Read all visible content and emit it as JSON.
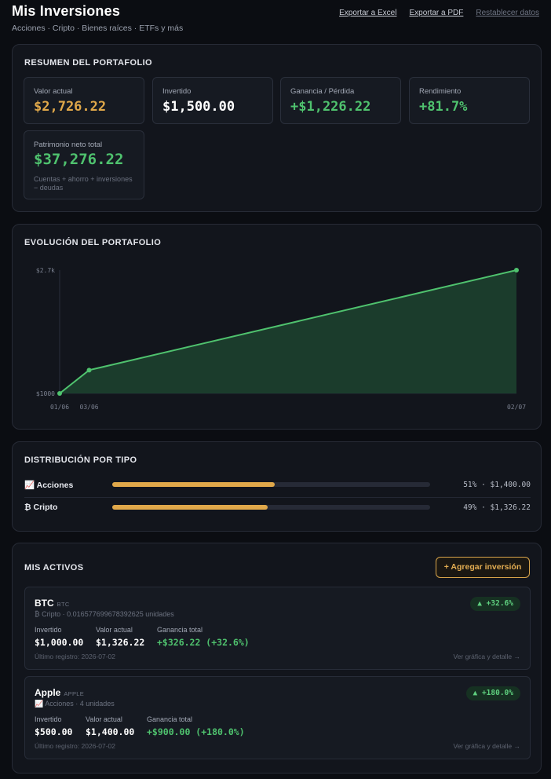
{
  "header": {
    "title": "Mis Inversiones",
    "subtitle": "Acciones · Cripto · Bienes raíces · ETFs y más",
    "links": [
      "Exportar a Excel",
      "Exportar a PDF",
      "Restablecer datos"
    ]
  },
  "summary": {
    "title": "RESUMEN DEL PORTAFOLIO",
    "stats": [
      {
        "label": "Valor actual",
        "value": "$2,726.22",
        "color": "#e0a84a"
      },
      {
        "label": "Invertido",
        "value": "$1,500.00",
        "color": "#ffffff"
      },
      {
        "label": "Ganancia / Pérdida",
        "value": "+$1,226.22",
        "color": "#4fc26e"
      },
      {
        "label": "Rendimiento",
        "value": "+81.7%",
        "color": "#4fc26e"
      }
    ],
    "net_worth": {
      "label": "Patrimonio neto total",
      "value": "$37,276.22",
      "note": "Cuentas + ahorro + inversiones − deudas"
    }
  },
  "evolution": {
    "title": "EVOLUCIÓN DEL PORTAFOLIO"
  },
  "chart_data": {
    "type": "area",
    "title": "",
    "x": [
      "01/06",
      "03/06",
      "02/07"
    ],
    "values": [
      1000,
      1326.22,
      2726.22
    ],
    "y_tick_labels": [
      "$2.7k",
      "$1000"
    ],
    "ylim": [
      1000,
      2726.22
    ],
    "xlabel": "",
    "ylabel": "",
    "grid": false,
    "line_color": "#4fc26e"
  },
  "distribution": {
    "title": "DISTRIBUCIÓN POR TIPO",
    "items": [
      {
        "icon": "📈",
        "name": "Acciones",
        "fraction": 0.51,
        "amount": "51% · $1,400.00"
      },
      {
        "icon": "₿",
        "name": "Cripto",
        "fraction": 0.49,
        "amount": "49% · $1,326.22"
      }
    ]
  },
  "assets": {
    "title": "MIS ACTIVOS",
    "add_button": "+ Agregar inversión",
    "items": [
      {
        "name": "BTC",
        "ticker": "BTC",
        "sub": "₿ Cripto · 0.016577699678392625 unidades",
        "badge": "▲ +32.6%",
        "invested_label": "Invertido",
        "invested": "$1,000.00",
        "current_label": "Valor actual",
        "current": "$1,326.22",
        "gain_label": "Ganancia total",
        "gain": "+$326.22 (+32.6%)",
        "last": "Último registro: 2026-07-02",
        "link": "Ver gráfica y detalle →"
      },
      {
        "name": "Apple",
        "ticker": "APPLE",
        "sub": "📈 Acciones · 4 unidades",
        "badge": "▲ +180.0%",
        "invested_label": "Invertido",
        "invested": "$500.00",
        "current_label": "Valor actual",
        "current": "$1,400.00",
        "gain_label": "Ganancia total",
        "gain": "+$900.00 (+180.0%)",
        "last": "Último registro: 2026-07-02",
        "link": "Ver gráfica y detalle →"
      }
    ]
  }
}
